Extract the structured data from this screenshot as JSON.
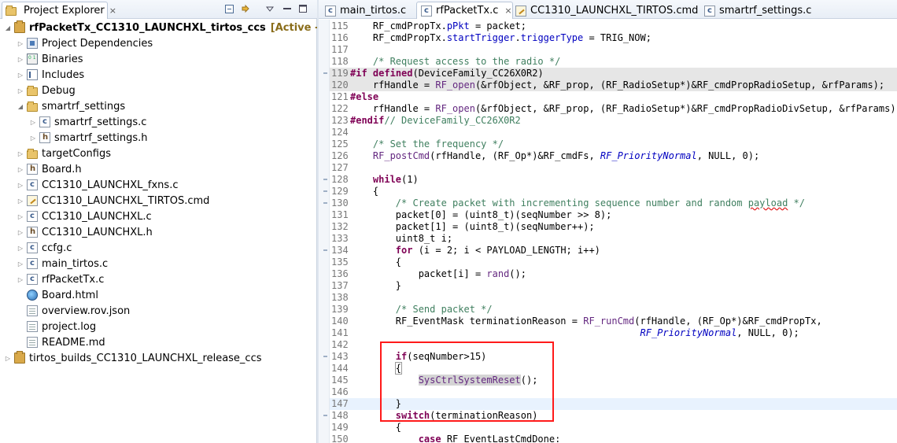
{
  "explorer": {
    "title": "Project Explorer",
    "close": "×",
    "controls": [
      "minimize",
      "link",
      "menu",
      "minimize2",
      "maximize"
    ]
  },
  "tree": [
    {
      "label": "rfPacketTx_CC1310_LAUNCHXL_tirtos_ccs",
      "suffix": "[Active - Debug]",
      "icon": "project-icon",
      "depth": 0,
      "twisty": "open"
    },
    {
      "label": "Project Dependencies",
      "icon": "dependencies-icon",
      "depth": 1,
      "twisty": "closed"
    },
    {
      "label": "Binaries",
      "icon": "binaries-icon",
      "depth": 1,
      "twisty": "closed"
    },
    {
      "label": "Includes",
      "icon": "includes-icon",
      "depth": 1,
      "twisty": "closed"
    },
    {
      "label": "Debug",
      "icon": "folder-icon",
      "depth": 1,
      "twisty": "closed"
    },
    {
      "label": "smartrf_settings",
      "icon": "folder-icon",
      "depth": 1,
      "twisty": "open"
    },
    {
      "label": "smartrf_settings.c",
      "icon": "c-file-icon",
      "depth": 2,
      "twisty": "closed"
    },
    {
      "label": "smartrf_settings.h",
      "icon": "h-file-icon",
      "depth": 2,
      "twisty": "closed"
    },
    {
      "label": "targetConfigs",
      "icon": "folder-icon",
      "depth": 1,
      "twisty": "closed"
    },
    {
      "label": "Board.h",
      "icon": "h-file-icon",
      "depth": 1,
      "twisty": "closed"
    },
    {
      "label": "CC1310_LAUNCHXL_fxns.c",
      "icon": "c-file-icon",
      "depth": 1,
      "twisty": "closed"
    },
    {
      "label": "CC1310_LAUNCHXL_TIRTOS.cmd",
      "icon": "cmd-file-icon",
      "depth": 1,
      "twisty": "closed"
    },
    {
      "label": "CC1310_LAUNCHXL.c",
      "icon": "c-file-icon",
      "depth": 1,
      "twisty": "closed"
    },
    {
      "label": "CC1310_LAUNCHXL.h",
      "icon": "h-file-icon",
      "depth": 1,
      "twisty": "closed"
    },
    {
      "label": "ccfg.c",
      "icon": "c-file-icon",
      "depth": 1,
      "twisty": "closed"
    },
    {
      "label": "main_tirtos.c",
      "icon": "c-file-icon",
      "depth": 1,
      "twisty": "closed"
    },
    {
      "label": "rfPacketTx.c",
      "icon": "c-file-icon",
      "depth": 1,
      "twisty": "closed"
    },
    {
      "label": "Board.html",
      "icon": "html-file-icon",
      "depth": 1,
      "twisty": "none"
    },
    {
      "label": "overview.rov.json",
      "icon": "text-file-icon",
      "depth": 1,
      "twisty": "none"
    },
    {
      "label": "project.log",
      "icon": "text-file-icon",
      "depth": 1,
      "twisty": "none"
    },
    {
      "label": "README.md",
      "icon": "text-file-icon",
      "depth": 1,
      "twisty": "none"
    },
    {
      "label": "tirtos_builds_CC1310_LAUNCHXL_release_ccs",
      "icon": "project-icon",
      "depth": 0,
      "twisty": "closed"
    }
  ],
  "editor_tabs": [
    {
      "label": "main_tirtos.c",
      "icon": "c-file-icon",
      "active": false
    },
    {
      "label": "rfPacketTx.c",
      "icon": "c-file-icon",
      "active": true,
      "close": "×"
    },
    {
      "label": "CC1310_LAUNCHXL_TIRTOS.cmd",
      "icon": "cmd-file-icon",
      "active": false
    },
    {
      "label": "smartrf_settings.c",
      "icon": "c-file-icon",
      "active": false
    }
  ],
  "code_lines": [
    {
      "n": "115",
      "t": "    RF_cmdPropTx.pPkt = packet;"
    },
    {
      "n": "116",
      "t": "    RF_cmdPropTx.startTrigger.triggerType = TRIG_NOW;"
    },
    {
      "n": "117",
      "t": ""
    },
    {
      "n": "118",
      "t": "    /* Request access to the radio */"
    },
    {
      "n": "119",
      "t": "#if defined(DeviceFamily_CC26X0R2)"
    },
    {
      "n": "120",
      "t": "    rfHandle = RF_open(&rfObject, &RF_prop, (RF_RadioSetup*)&RF_cmdPropRadioSetup, &rfParams);"
    },
    {
      "n": "121",
      "t": "#else"
    },
    {
      "n": "122",
      "t": "    rfHandle = RF_open(&rfObject, &RF_prop, (RF_RadioSetup*)&RF_cmdPropRadioDivSetup, &rfParams);"
    },
    {
      "n": "123",
      "t": "#endif// DeviceFamily_CC26X0R2"
    },
    {
      "n": "124",
      "t": ""
    },
    {
      "n": "125",
      "t": "    /* Set the frequency */"
    },
    {
      "n": "126",
      "t": "    RF_postCmd(rfHandle, (RF_Op*)&RF_cmdFs, RF_PriorityNormal, NULL, 0);"
    },
    {
      "n": "127",
      "t": ""
    },
    {
      "n": "128",
      "t": "    while(1)"
    },
    {
      "n": "129",
      "t": "    {"
    },
    {
      "n": "130",
      "t": "        /* Create packet with incrementing sequence number and random payload */"
    },
    {
      "n": "131",
      "t": "        packet[0] = (uint8_t)(seqNumber >> 8);"
    },
    {
      "n": "132",
      "t": "        packet[1] = (uint8_t)(seqNumber++);"
    },
    {
      "n": "133",
      "t": "        uint8_t i;"
    },
    {
      "n": "134",
      "t": "        for (i = 2; i < PAYLOAD_LENGTH; i++)"
    },
    {
      "n": "135",
      "t": "        {"
    },
    {
      "n": "136",
      "t": "            packet[i] = rand();"
    },
    {
      "n": "137",
      "t": "        }"
    },
    {
      "n": "138",
      "t": ""
    },
    {
      "n": "139",
      "t": "        /* Send packet */"
    },
    {
      "n": "140",
      "t": "        RF_EventMask terminationReason = RF_runCmd(rfHandle, (RF_Op*)&RF_cmdPropTx,"
    },
    {
      "n": "141",
      "t": "                                                   RF_PriorityNormal, NULL, 0);"
    },
    {
      "n": "142",
      "t": ""
    },
    {
      "n": "143",
      "t": "        if(seqNumber>15)"
    },
    {
      "n": "144",
      "t": "        {"
    },
    {
      "n": "145",
      "t": "            SysCtrlSystemReset();"
    },
    {
      "n": "146",
      "t": ""
    },
    {
      "n": "147",
      "t": "        }"
    },
    {
      "n": "148",
      "t": "        switch(terminationReason)"
    },
    {
      "n": "149",
      "t": "        {"
    },
    {
      "n": "150",
      "t": "            case RF_EventLastCmdDone:"
    }
  ],
  "colors": {
    "keyword": "#7f0055",
    "comment": "#3f7f5f",
    "function": "#642880",
    "field": "#0000c0",
    "annotation_box": "#ff1a1a",
    "active_tag": "#8a6d1a"
  }
}
